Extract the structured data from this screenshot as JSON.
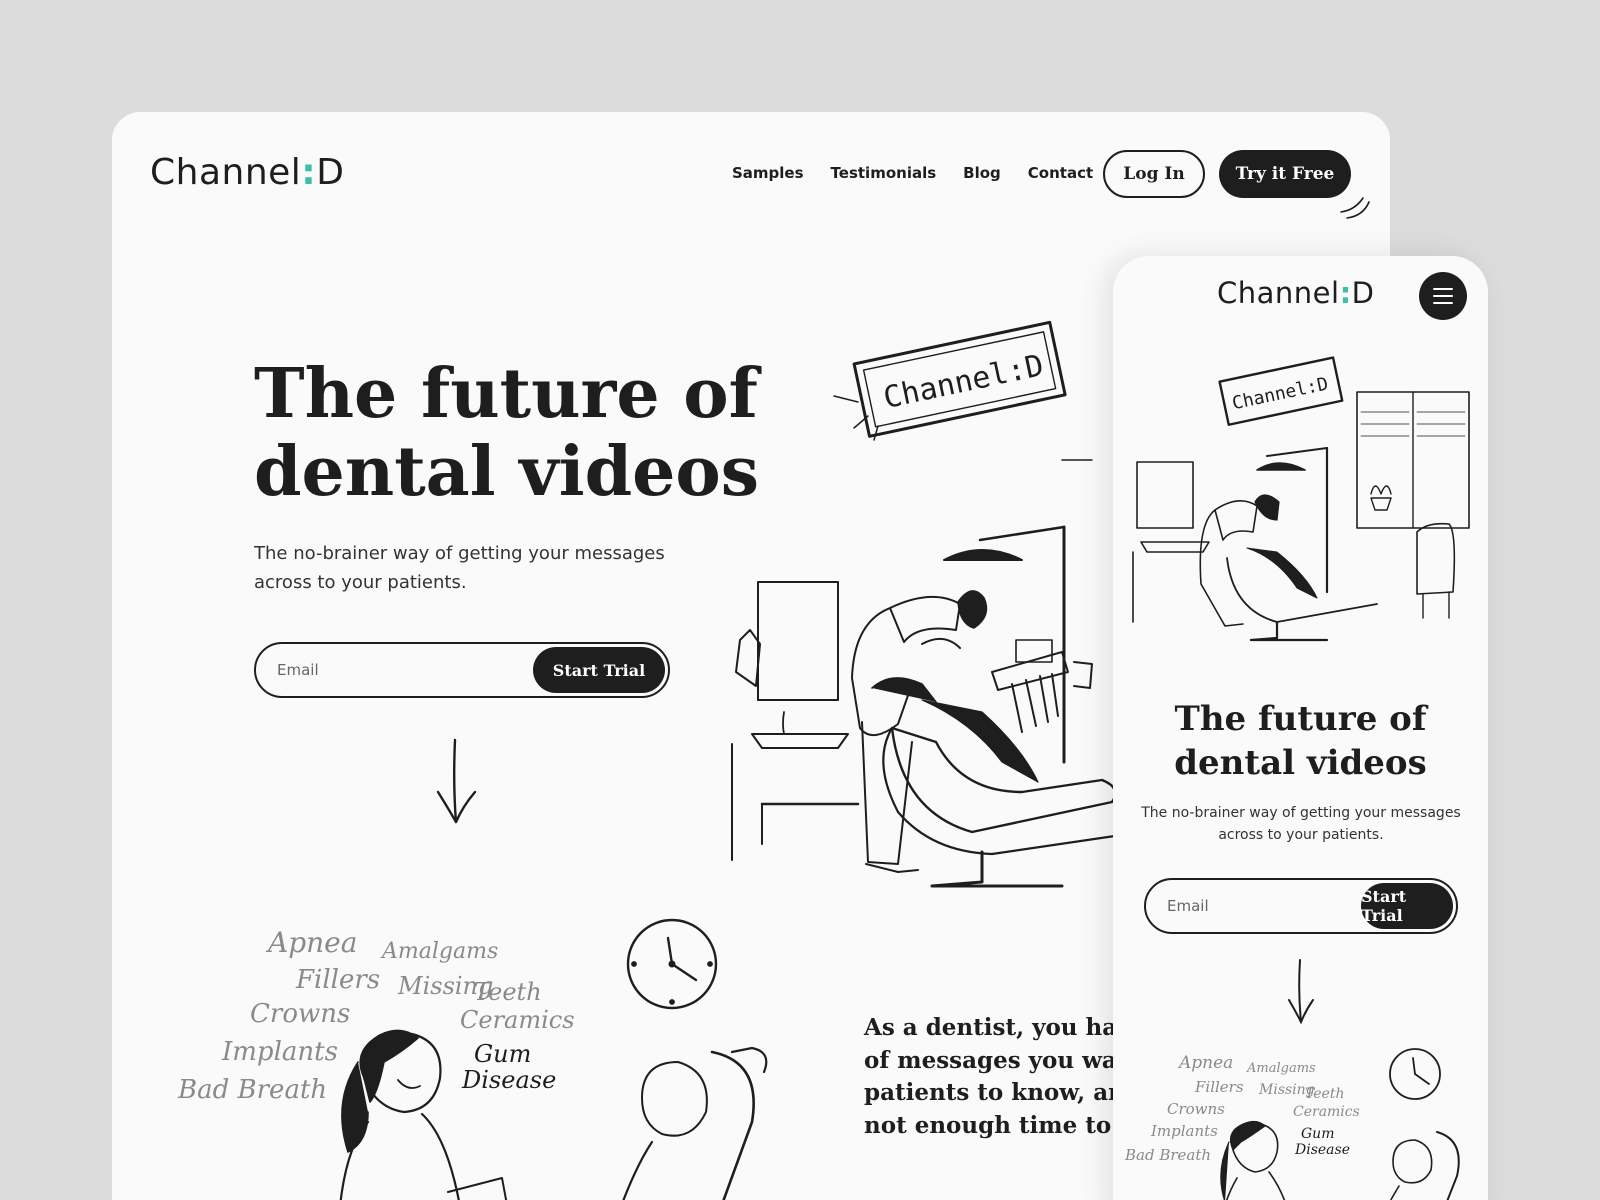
{
  "brand": {
    "name": "Channel",
    "separator": ":",
    "letter": "D",
    "accent_color": "#3cbfa6"
  },
  "nav": {
    "items": [
      {
        "label": "Samples"
      },
      {
        "label": "Testimonials"
      },
      {
        "label": "Blog"
      },
      {
        "label": "Contact"
      }
    ],
    "login_label": "Log In",
    "try_label": "Try it Free"
  },
  "hero": {
    "title_line1": "The future of",
    "title_line2": "dental videos",
    "subtitle": "The no-brainer way of getting your messages across to your patients.",
    "email_placeholder": "Email",
    "cta_label": "Start Trial",
    "sign_text": "Channel:D"
  },
  "topics": {
    "words": [
      "Apnea",
      "Amalgams",
      "Fillers",
      "Missing",
      "Teeth",
      "Crowns",
      "Ceramics",
      "Implants",
      "Gum",
      "Disease",
      "Bad Breath"
    ]
  },
  "section2": {
    "text": "As a dentist, you have of messages you want patients to know, and not enough time to s"
  },
  "mobile": {
    "menu_icon": "hamburger-menu-icon"
  },
  "colors": {
    "dark": "#1e1e1e",
    "page_bg": "#dcdcdc",
    "card_bg": "#fafafa",
    "accent": "#3cbfa6"
  }
}
